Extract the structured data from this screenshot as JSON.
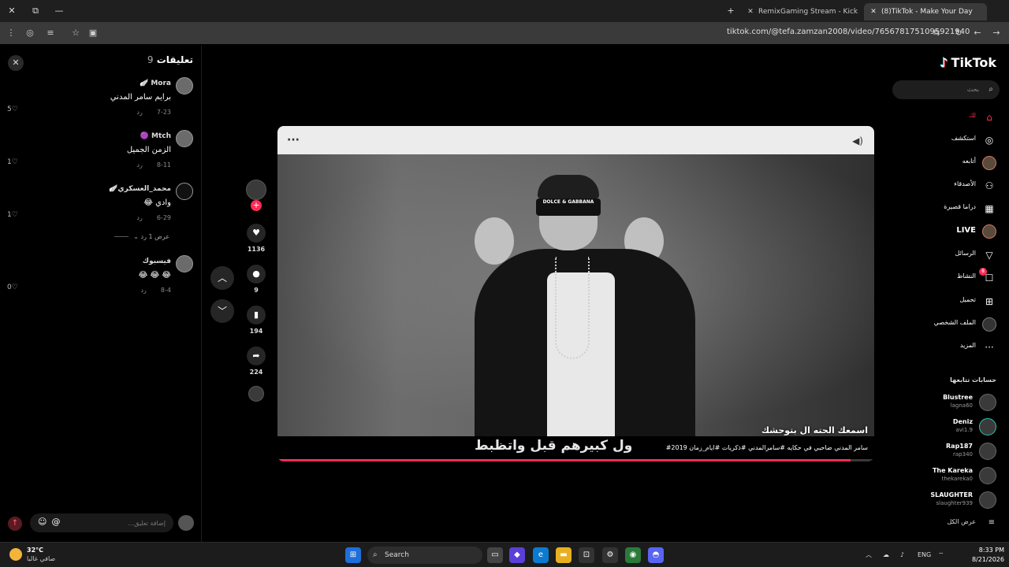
{
  "browser": {
    "tabs": [
      {
        "title": "RemixGaming Stream - Kick Da",
        "active": false
      },
      {
        "title": "(8)TikTok - Make Your Day",
        "active": true
      }
    ],
    "url": "tiktok.com/@tefa.zamzan2008/video/7656781751095921940"
  },
  "comments": {
    "title": "تعليقات",
    "count": "9",
    "items": [
      {
        "user": "Mora 🪽",
        "text": "برايم سامر المدني",
        "date": "7-23",
        "reply": "رد",
        "likes": "5♡"
      },
      {
        "user": "Mtch 🟣",
        "text": "الزمن الجميل",
        "date": "8-11",
        "reply": "رد",
        "likes": "1♡"
      },
      {
        "user": "محمد_العسكري🪽",
        "text": "وادي 😂",
        "date": "6-29",
        "reply": "رد",
        "likes": "1♡"
      },
      {
        "user": "فيسبوك",
        "text": "😂 😂 😂",
        "date": "8-4",
        "reply": "رد",
        "likes": "0♡"
      }
    ],
    "view_replies": "عرض 1 رد ⌄",
    "input_placeholder": "إضافة تعليق..."
  },
  "actions": {
    "likes": "1136",
    "comments": "9",
    "saves": "194",
    "shares": "224"
  },
  "video": {
    "username": "اسمعك الحته ال بتوحشك",
    "caption": "سامر المدني ضاحبي في حكايه #سامرالمدني #ذكريات #ايام_زمان 2019#",
    "lyric_overlay": "ول كبيرهم قبل واتظبط",
    "glasses_brand": "DOLCE & GABBANA",
    "progress": 0.96
  },
  "sidebar": {
    "logo": "TikTok",
    "search_placeholder": "بحث",
    "nav": [
      {
        "label": "لك",
        "icon": "home-icon",
        "active": true
      },
      {
        "label": "استكشف",
        "icon": "compass-icon"
      },
      {
        "label": "أتابعه",
        "icon": "following-avatar-icon"
      },
      {
        "label": "الأصدقاء",
        "icon": "friends-icon"
      },
      {
        "label": "دراما قصيرة",
        "icon": "drama-icon"
      },
      {
        "label": "LIVE",
        "icon": "live-icon"
      },
      {
        "label": "الرسائل",
        "icon": "messages-icon"
      },
      {
        "label": "النشاط",
        "icon": "activity-icon",
        "badge": "8"
      },
      {
        "label": "تحميل",
        "icon": "upload-icon"
      },
      {
        "label": "الملف الشخصي",
        "icon": "profile-icon"
      },
      {
        "label": "المزيد",
        "icon": "more-icon"
      }
    ],
    "following_title": "حسابات تتابعها",
    "following": [
      {
        "name": "Blustree",
        "handle": "lagna60"
      },
      {
        "name": "Deniz",
        "handle": "avi1.9"
      },
      {
        "name": "Rap187",
        "handle": "rap340"
      },
      {
        "name": "The Kareka",
        "handle": "thekareka0"
      },
      {
        "name": "SLAUGHTER",
        "handle": "slaughter939"
      }
    ],
    "see_all": "عرض الكل"
  },
  "taskbar": {
    "weather_temp": "32°C",
    "weather_desc": "صافي غالبا",
    "search_label": "Search",
    "lang": "ENG",
    "time": "8:33 PM",
    "date": "8/21/2026"
  }
}
